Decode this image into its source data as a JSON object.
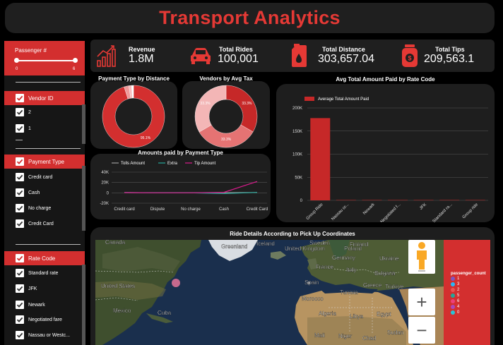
{
  "app": {
    "title": "Transport Analytics"
  },
  "sidebar": {
    "passenger": {
      "label": "Passenger #",
      "min": "0",
      "max": "6"
    },
    "vendor": {
      "header": "Vendor ID",
      "items": [
        "2",
        "1"
      ]
    },
    "payment": {
      "header": "Payment Type",
      "items": [
        "Credit card",
        "Cash",
        "No charge",
        "Credit Card"
      ]
    },
    "rate": {
      "header": "Rate Code",
      "items": [
        "Standard rate",
        "JFK",
        "Newark",
        "Negotiated fare",
        "Nassau or Westc..."
      ]
    }
  },
  "kpis": [
    {
      "label": "Revenue",
      "value": "1.8M",
      "icon": "chart-growth-icon"
    },
    {
      "label": "Total Rides",
      "value": "100,001",
      "icon": "car-icon"
    },
    {
      "label": "Total Distance",
      "value": "303,657.04",
      "icon": "fuel-can-icon"
    },
    {
      "label": "Total Tips",
      "value": "209,563.1",
      "icon": "money-jar-icon"
    }
  ],
  "charts": {
    "payment_donut_title": "Payment Type by Distance",
    "vendor_donut_title": "Vendors by Avg Tax",
    "line_title": "Amounts paid by Payment Type",
    "bar_title": "Avg Total Amount Paid by Rate Code",
    "map_title": "Ride Details According to Pick Up Coordinates"
  },
  "chart_data": [
    {
      "type": "pie",
      "title": "Payment Type by Distance",
      "slices": [
        {
          "label": "95.1%",
          "value": 95.1,
          "color": "#d32f2f"
        },
        {
          "label": "",
          "value": 2.5,
          "color": "#ef9a9a"
        },
        {
          "label": "",
          "value": 1.4,
          "color": "#f8bbbb"
        },
        {
          "label": "",
          "value": 1.0,
          "color": "#ffffff"
        }
      ]
    },
    {
      "type": "pie",
      "title": "Vendors by Avg Tax",
      "slices": [
        {
          "label": "33.3%",
          "value": 33.3,
          "color": "#c62828"
        },
        {
          "label": "33.3%",
          "value": 33.3,
          "color": "#e57373"
        },
        {
          "label": "33.3%",
          "value": 33.4,
          "color": "#f3b6b6"
        }
      ]
    },
    {
      "type": "line",
      "title": "Amounts paid by Payment Type",
      "categories": [
        "Credit card",
        "Dispute",
        "No charge",
        "Cash",
        "Credit Card"
      ],
      "ylim": [
        -20000,
        40000
      ],
      "yticks": [
        "40K",
        "20K",
        "0",
        "-20K"
      ],
      "yticks_values": [
        40000,
        20000,
        0,
        -20000
      ],
      "series": [
        {
          "name": "Tolls Amount",
          "color": "#9e9e9e",
          "values": [
            500,
            100,
            100,
            300,
            600
          ]
        },
        {
          "name": "Extra",
          "color": "#26a69a",
          "values": [
            600,
            50,
            50,
            -1500,
            900
          ]
        },
        {
          "name": "Tip Amount",
          "color": "#d81b8c",
          "values": [
            500,
            50,
            0,
            1000,
            22000
          ]
        }
      ]
    },
    {
      "type": "bar",
      "title": "Avg Total Amount Paid by Rate Code",
      "legend": "Average Total Amount Paid",
      "categories": [
        "Group Ride",
        "Nassau or...",
        "Newark",
        "Negotiated f...",
        "JFK",
        "Standard ra...",
        "Group ride"
      ],
      "values": [
        178000,
        150,
        110,
        90,
        80,
        20,
        10
      ],
      "ylim": [
        0,
        200000
      ],
      "yticks": [
        "200K",
        "150K",
        "100K",
        "50K",
        "0"
      ],
      "yticks_values": [
        200000,
        150000,
        100000,
        50000,
        0
      ],
      "color": "#c62828"
    }
  ],
  "map": {
    "legend_title": "passenger_count",
    "legend_items": [
      {
        "label": "1",
        "color": "#7e57c2"
      },
      {
        "label": "3",
        "color": "#29b6f6"
      },
      {
        "label": "2",
        "color": "#ef5350"
      },
      {
        "label": "5",
        "color": "#26a69a"
      },
      {
        "label": "6",
        "color": "#ec407a"
      },
      {
        "label": "4",
        "color": "#ab47bc"
      },
      {
        "label": "0",
        "color": "#26c6da"
      }
    ],
    "labels": {
      "canada": "Canada",
      "greenland": "Greenland",
      "iceland": "Iceland",
      "sweden": "Sweden",
      "finland": "Finland",
      "uk": "United Kingdom",
      "poland": "Poland",
      "germany": "Germany",
      "ukraine": "Ukraine",
      "france": "France",
      "spain": "Spain",
      "italy": "Italy",
      "us": "United States",
      "turkiye": "Türkiye",
      "mexico": "Mexico",
      "algeria": "Algeria",
      "libya": "Libya",
      "egypt": "Egypt",
      "mali": "Mali",
      "niger": "Niger",
      "chad": "Chad",
      "sudan": "Sudan",
      "bulgaria": "Bulgaria",
      "tunisia": "Tunisia",
      "morocco": "Morocco",
      "greece": "Greece",
      "cuba": "Cuba"
    },
    "zoom_in": "+",
    "zoom_out": "−"
  }
}
